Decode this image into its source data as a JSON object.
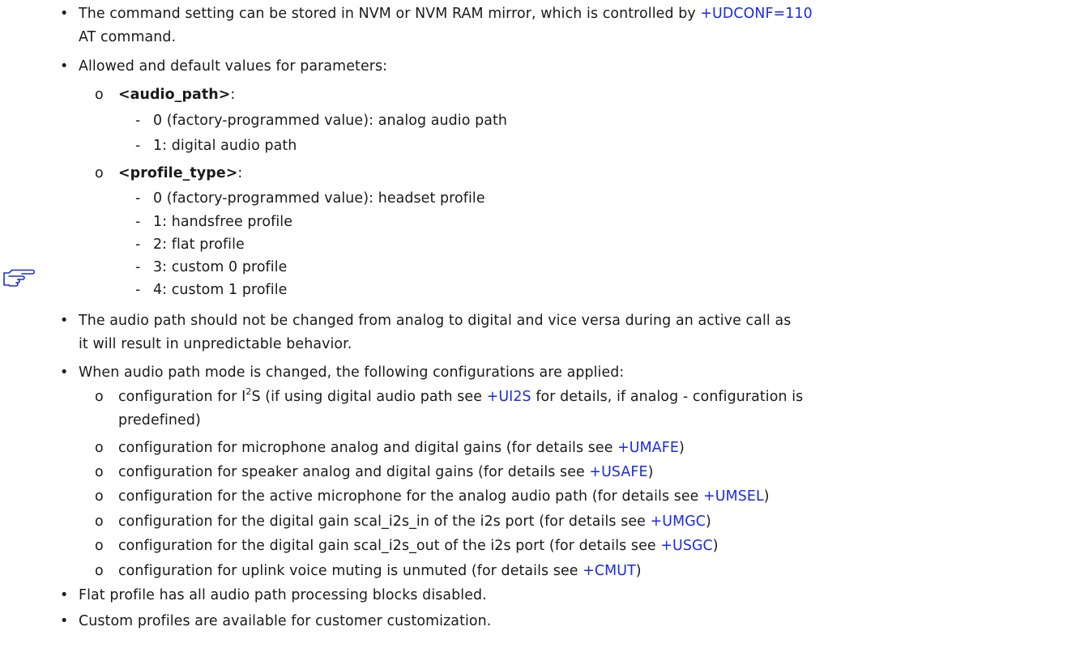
{
  "markers": {
    "bullet": "•",
    "sub": "o",
    "dash": "-"
  },
  "colors": {
    "text": "#1a1a1a",
    "link": "#1a2be0"
  },
  "note_icon": "pointing-hand-icon",
  "section1": {
    "item1": {
      "pre": "The command setting can be stored in NVM or NVM RAM mirror, which is controlled by ",
      "link": "+UDCONF=110",
      "cont": "AT command."
    },
    "item2": {
      "text": "Allowed and default values for parameters:",
      "audio_path": {
        "name": "<audio_path>",
        "suffix": ":",
        "values": [
          "0 (factory-programmed value): analog audio path",
          "1: digital audio path"
        ]
      },
      "profile_type": {
        "name": "<profile_type>",
        "suffix": ":",
        "values": [
          "0 (factory-programmed value): headset profile",
          "1: handsfree profile",
          "2: flat profile",
          "3: custom 0 profile",
          "4: custom 1 profile"
        ]
      }
    }
  },
  "notes": {
    "note1": {
      "line1": "The audio path should not be changed from analog to digital and vice versa during an active call as",
      "line2": "it will result in unpredictable behavior."
    },
    "note2": {
      "text": "When audio path mode is changed, the following configurations are applied:",
      "i2s": {
        "pre": "configuration for I",
        "sup": "2",
        "mid": "S (if using digital audio path see ",
        "link": "+UI2S",
        "post": " for details, if analog - configuration is",
        "cont": "predefined)"
      },
      "configs": [
        {
          "pre": "configuration for microphone analog and digital gains (for details see ",
          "link": "+UMAFE",
          "post": ")"
        },
        {
          "pre": "configuration for speaker analog and digital gains (for details see ",
          "link": "+USAFE",
          "post": ")"
        },
        {
          "pre": "configuration for the active microphone for the analog audio path (for details see ",
          "link": "+UMSEL",
          "post": ")"
        },
        {
          "pre": "configuration for the digital gain scal_i2s_in of the i2s port (for details see ",
          "link": "+UMGC",
          "post": ")"
        },
        {
          "pre": "configuration for the digital gain scal_i2s_out of the i2s port (for details see ",
          "link": "+USGC",
          "post": ")"
        },
        {
          "pre": "configuration for uplink voice muting is unmuted (for details see ",
          "link": "+CMUT",
          "post": ")"
        }
      ]
    },
    "note3": "Flat profile has all audio path processing blocks disabled.",
    "note4": "Custom profiles are available for customer customization."
  }
}
